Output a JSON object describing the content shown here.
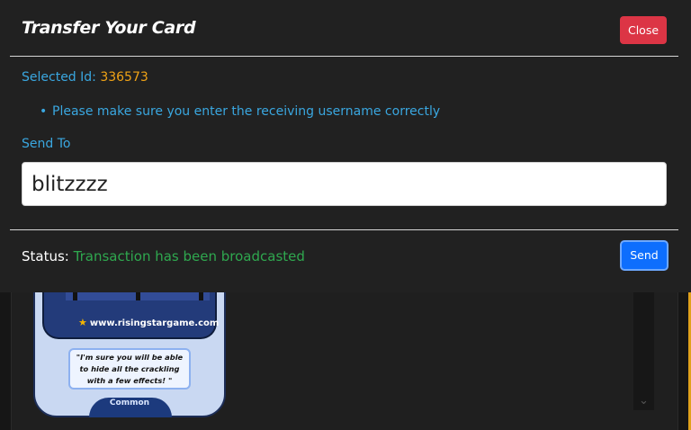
{
  "modal": {
    "title": "Transfer Your Card",
    "close_label": "Close",
    "selected_id_label": "Selected Id:",
    "selected_id_value": "336573",
    "notice_bullet": "•",
    "notice": "Please make sure you enter the receiving username correctly",
    "send_to_label": "Send To",
    "username_value": "blitzzzz",
    "status_label": "Status:",
    "status_value": "Transaction has been broadcasted",
    "send_label": "Send"
  },
  "card": {
    "url": "www.risingstargame.com",
    "star_icon": "★",
    "quote_line1": "\"I'm sure you will be able",
    "quote_line2": "to hide all the crackling",
    "quote_line3": "with a few effects! \"",
    "rarity": "Common"
  },
  "background": {
    "scroll_arrow": "⌄"
  },
  "colors": {
    "accent_label": "#3aa7e0",
    "id_value": "#f0a316",
    "status_success": "#2fa84f",
    "close_button": "#dc3545",
    "send_button": "#0d6efd",
    "modal_bg": "#212121"
  }
}
